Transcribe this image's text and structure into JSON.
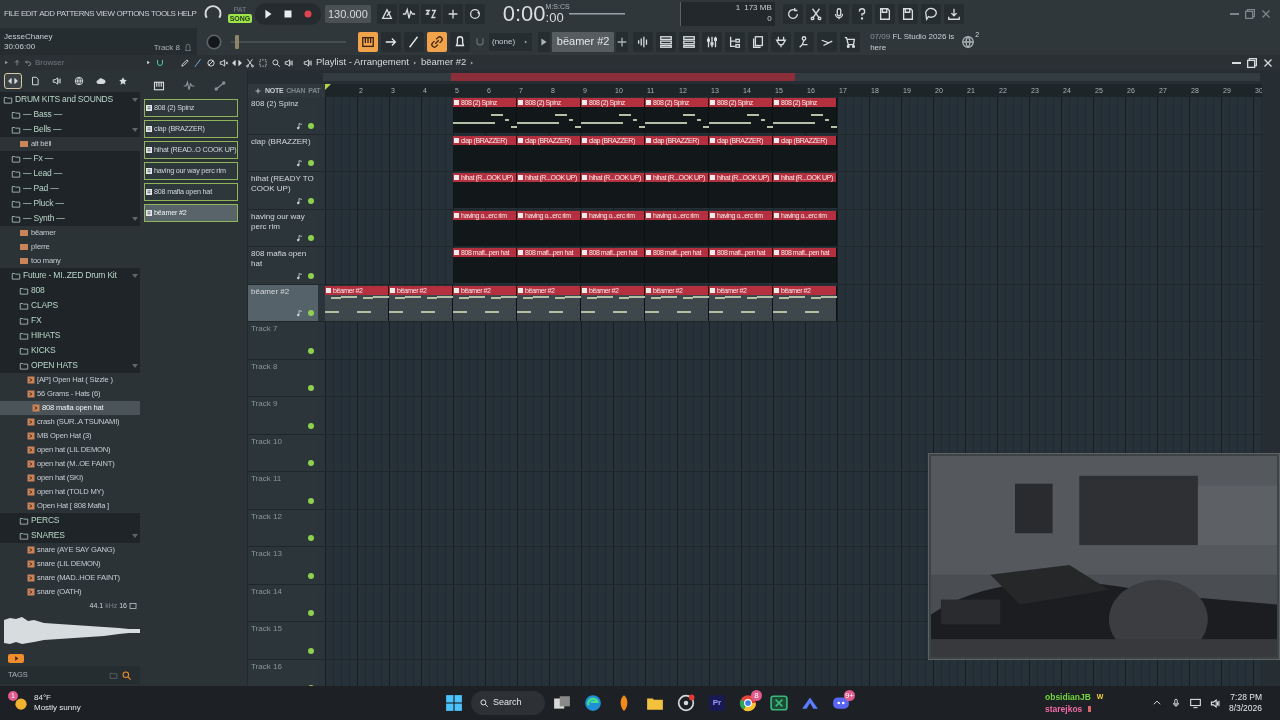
{
  "menu": [
    "FILE",
    "EDIT",
    "ADD",
    "PATTERNS",
    "VIEW",
    "OPTIONS",
    "TOOLS",
    "HELP"
  ],
  "transport": {
    "modes": [
      {
        "label": "PAT",
        "selected": false
      },
      {
        "label": "SONG",
        "selected": true
      }
    ],
    "tempo": "130.000",
    "time_format": "M:S:CS",
    "time": "0:00",
    "time_fraction": ":00"
  },
  "hint_bar": {
    "user": "JesseChaney",
    "time": "30:06:00",
    "target": "Track 8"
  },
  "master_pitch": {
    "level": 0.04
  },
  "monitor": {
    "cpu": "1",
    "memory": "173 MB",
    "voices": "0"
  },
  "snap": "(none)",
  "pattern": "bëamer #2",
  "news": {
    "date": "07/09",
    "text": "FL Studio 2026 is here",
    "badge": "2"
  },
  "browser": {
    "title": "Browser",
    "tabs": [
      {
        "kind": "all",
        "selected": true
      },
      {
        "kind": "files",
        "selected": false
      },
      {
        "kind": "plugins",
        "selected": false
      },
      {
        "kind": "web",
        "selected": false
      },
      {
        "kind": "cloud",
        "selected": false
      },
      {
        "kind": "favorites",
        "selected": false
      }
    ],
    "tree": [
      {
        "kind": "folder",
        "label": "DRUM KITS and SOUNDS",
        "selected": false,
        "expanded": true,
        "children": [
          {
            "kind": "folder",
            "label": "— Bass —",
            "selected": false,
            "expanded": false
          },
          {
            "kind": "folder",
            "label": "— Bells —",
            "selected": false,
            "expanded": true,
            "children": [
              {
                "kind": "mp3",
                "label": "alt bëll",
                "selected": false
              }
            ]
          },
          {
            "kind": "folder",
            "label": "— Fx —",
            "selected": false,
            "expanded": false
          },
          {
            "kind": "folder",
            "label": "— Lead —",
            "selected": false,
            "expanded": false
          },
          {
            "kind": "folder",
            "label": "— Pad —",
            "selected": false,
            "expanded": false
          },
          {
            "kind": "folder",
            "label": "— Pluck —",
            "selected": false,
            "expanded": false
          },
          {
            "kind": "folder",
            "label": "— Synth —",
            "selected": false,
            "expanded": true,
            "children": [
              {
                "kind": "mp3",
                "label": "bëamer",
                "selected": false
              },
              {
                "kind": "mp3",
                "label": "pïerre",
                "selected": false
              },
              {
                "kind": "mp3",
                "label": "too many",
                "selected": false
              }
            ]
          },
          {
            "kind": "folder",
            "label": "Future - MI..ZED Drum Kit",
            "selected": false,
            "expanded": true,
            "children": [
              {
                "kind": "folder",
                "label": "808",
                "selected": false,
                "expanded": false
              },
              {
                "kind": "folder",
                "label": "CLAPS",
                "selected": false,
                "expanded": false
              },
              {
                "kind": "folder",
                "label": "FX",
                "selected": false,
                "expanded": false
              },
              {
                "kind": "folder",
                "label": "HIHATS",
                "selected": false,
                "expanded": false
              },
              {
                "kind": "folder",
                "label": "KICKS",
                "selected": false,
                "expanded": false
              },
              {
                "kind": "folder",
                "label": "OPEN HATS",
                "selected": false,
                "expanded": true,
                "children": [
                  {
                    "kind": "wav",
                    "label": "[AP] Open Hat ( Sizzle )",
                    "selected": false
                  },
                  {
                    "kind": "wav",
                    "label": "56 Grams - Hats (6)",
                    "selected": false
                  },
                  {
                    "kind": "wav",
                    "label": "808 mafia open hat",
                    "selected": true
                  },
                  {
                    "kind": "wav",
                    "label": "crash (SUR..A TSUNAMI)",
                    "selected": false
                  },
                  {
                    "kind": "wav",
                    "label": "MB Open Hat (3)",
                    "selected": false
                  },
                  {
                    "kind": "wav",
                    "label": "open hat (LIL DEMON)",
                    "selected": false
                  },
                  {
                    "kind": "wav",
                    "label": "open hat (M..OE FAINT)",
                    "selected": false
                  },
                  {
                    "kind": "wav",
                    "label": "open hat (SKI)",
                    "selected": false
                  },
                  {
                    "kind": "wav",
                    "label": "open hat (TOLD MY)",
                    "selected": false
                  },
                  {
                    "kind": "wav",
                    "label": "Open Hat [ 808 Mafia ]",
                    "selected": false
                  }
                ]
              },
              {
                "kind": "folder",
                "label": "PERCS",
                "selected": false,
                "expanded": false
              },
              {
                "kind": "folder",
                "label": "SNARES",
                "selected": false,
                "expanded": true,
                "children": [
                  {
                    "kind": "wav",
                    "label": "snare (AYE SAY GANG)",
                    "selected": false
                  },
                  {
                    "kind": "wav",
                    "label": "snare (LIL DEMON)",
                    "selected": false
                  },
                  {
                    "kind": "wav",
                    "label": "snare (MAD..HOE FAINT)",
                    "selected": false
                  },
                  {
                    "kind": "wav",
                    "label": "snare (OATH)",
                    "selected": false
                  }
                ]
              }
            ]
          }
        ]
      }
    ],
    "sample": {
      "rate": "44.1",
      "unit": "kHz",
      "bits": "16"
    },
    "tags_label": "TAGS"
  },
  "playlist": {
    "title": "Playlist - Arrangement",
    "pattern": "bëamer #2",
    "filters": [
      "NOTE",
      "CHAN",
      "PAT"
    ],
    "patterns": [
      {
        "label": "808 (2) Spinz",
        "selected": false
      },
      {
        "label": "clap (BRAZZER)",
        "selected": false
      },
      {
        "label": "hihat (READ..O COOK UP)",
        "selected": false
      },
      {
        "label": "having our way perc rim",
        "selected": false
      },
      {
        "label": "808 mafia open hat",
        "selected": false
      },
      {
        "label": "bëamer #2",
        "selected": true
      }
    ],
    "bar_numbers": [
      "2",
      "3",
      "4",
      "5",
      "6",
      "7",
      "8",
      "9",
      "10",
      "11",
      "12",
      "13",
      "14",
      "15",
      "16",
      "17",
      "18",
      "19",
      "20",
      "21",
      "22",
      "23",
      "24",
      "25",
      "26",
      "27",
      "28",
      "29",
      "30"
    ],
    "tracks": [
      {
        "name": "808 (2) Spinz",
        "selected": false,
        "clips": [
          {
            "kind": "empty"
          },
          {
            "kind": "empty"
          },
          {
            "kind": "pattern",
            "label": "808 (2) Spinz"
          },
          {
            "kind": "pattern",
            "label": "808 (2) Spinz"
          },
          {
            "kind": "pattern",
            "label": "808 (2) Spinz"
          },
          {
            "kind": "pattern",
            "label": "808 (2) Spinz"
          },
          {
            "kind": "pattern",
            "label": "808 (2) Spinz"
          },
          {
            "kind": "pattern",
            "label": "808 (2) Spinz"
          }
        ]
      },
      {
        "name": "clap (BRAZZER)",
        "selected": false,
        "clips": [
          {
            "kind": "empty"
          },
          {
            "kind": "empty"
          },
          {
            "kind": "pattern",
            "label": "clap (BRAZZER)"
          },
          {
            "kind": "pattern",
            "label": "clap (BRAZZER)"
          },
          {
            "kind": "pattern",
            "label": "clap (BRAZZER)"
          },
          {
            "kind": "pattern",
            "label": "clap (BRAZZER)"
          },
          {
            "kind": "pattern",
            "label": "clap (BRAZZER)"
          },
          {
            "kind": "pattern",
            "label": "clap (BRAZZER)"
          }
        ]
      },
      {
        "name": "hihat (READY TO COOK UP)",
        "selected": false,
        "clips": [
          {
            "kind": "empty"
          },
          {
            "kind": "empty"
          },
          {
            "kind": "pattern",
            "label": "hihat (R...OOK UP)"
          },
          {
            "kind": "pattern",
            "label": "hihat (R...OOK UP)"
          },
          {
            "kind": "pattern",
            "label": "hihat (R...OOK UP)"
          },
          {
            "kind": "pattern",
            "label": "hihat (R...OOK UP)"
          },
          {
            "kind": "pattern",
            "label": "hihat (R...OOK UP)"
          },
          {
            "kind": "pattern",
            "label": "hihat (R...OOK UP)"
          }
        ]
      },
      {
        "name": "having our way perc rim",
        "selected": false,
        "clips": [
          {
            "kind": "empty"
          },
          {
            "kind": "empty"
          },
          {
            "kind": "pattern",
            "label": "having o...erc rim"
          },
          {
            "kind": "pattern",
            "label": "having o...erc rim"
          },
          {
            "kind": "pattern",
            "label": "having o...erc rim"
          },
          {
            "kind": "pattern",
            "label": "having o...erc rim"
          },
          {
            "kind": "pattern",
            "label": "having o...erc rim"
          },
          {
            "kind": "pattern",
            "label": "having o...erc rim"
          }
        ]
      },
      {
        "name": "808 mafia open hat",
        "selected": false,
        "clips": [
          {
            "kind": "empty"
          },
          {
            "kind": "empty"
          },
          {
            "kind": "pattern",
            "label": "808 mafi...pen hat"
          },
          {
            "kind": "pattern",
            "label": "808 mafi...pen hat"
          },
          {
            "kind": "pattern",
            "label": "808 mafi...pen hat"
          },
          {
            "kind": "pattern",
            "label": "808 mafi...pen hat"
          },
          {
            "kind": "pattern",
            "label": "808 mafi...pen hat"
          },
          {
            "kind": "pattern",
            "label": "808 mafi...pen hat"
          }
        ]
      },
      {
        "name": "bëamer #2",
        "selected": true,
        "clips": [
          {
            "kind": "pattern",
            "label": "bëamer #2"
          },
          {
            "kind": "pattern",
            "label": "bëamer #2"
          },
          {
            "kind": "pattern",
            "label": "bëamer #2"
          },
          {
            "kind": "pattern",
            "label": "bëamer #2"
          },
          {
            "kind": "pattern",
            "label": "bëamer #2"
          },
          {
            "kind": "pattern",
            "label": "bëamer #2"
          },
          {
            "kind": "pattern",
            "label": "bëamer #2"
          },
          {
            "kind": "pattern",
            "label": "bëamer #2"
          }
        ]
      },
      {
        "name": "Track 7",
        "selected": false
      },
      {
        "name": "Track 8",
        "selected": false
      },
      {
        "name": "Track 9",
        "selected": false
      },
      {
        "name": "Track 10",
        "selected": false
      },
      {
        "name": "Track 11",
        "selected": false
      },
      {
        "name": "Track 12",
        "selected": false
      },
      {
        "name": "Track 13",
        "selected": false
      },
      {
        "name": "Track 14",
        "selected": false
      },
      {
        "name": "Track 15",
        "selected": false
      },
      {
        "name": "Track 16",
        "selected": false
      }
    ]
  },
  "taskbar": {
    "weather": {
      "badge": "1",
      "temperature": "84°F",
      "condition": "Mostly sunny"
    },
    "search": "Search",
    "apps": [
      {
        "kind": "start"
      },
      {
        "kind": "search"
      },
      {
        "kind": "taskview"
      },
      {
        "kind": "edge"
      },
      {
        "kind": "fl"
      },
      {
        "kind": "files"
      },
      {
        "kind": "obs"
      },
      {
        "kind": "premiere",
        "label": "Pr"
      },
      {
        "kind": "chrome",
        "badge": "8"
      },
      {
        "kind": "excel"
      },
      {
        "kind": "vpn"
      },
      {
        "kind": "discord",
        "badge": "9+"
      }
    ],
    "chat": [
      {
        "name": "obsidianJB",
        "badge": "W",
        "color": "#72d63a"
      },
      {
        "name": "starejkos",
        "color": "#f06aa6"
      }
    ],
    "time": "7:28 PM",
    "date": "8/3/2026"
  }
}
